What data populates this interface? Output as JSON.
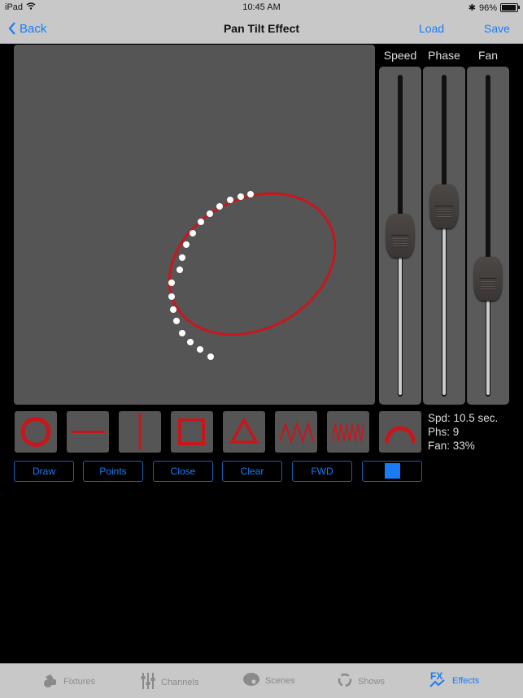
{
  "status_bar": {
    "device": "iPad",
    "time": "10:45 AM",
    "battery": "96%"
  },
  "nav": {
    "back_label": "Back",
    "title": "Pan Tilt Effect",
    "load_label": "Load",
    "save_label": "Save"
  },
  "sliders": [
    {
      "label": "Speed",
      "value_fraction": 0.5
    },
    {
      "label": "Phase",
      "value_fraction": 0.6
    },
    {
      "label": "Fan",
      "value_fraction": 0.35
    }
  ],
  "shapes": [
    "circle",
    "horizontal-line",
    "vertical-line",
    "square",
    "triangle",
    "zigzag",
    "zigzag-dense",
    "arc"
  ],
  "info": {
    "speed": "Spd: 10.5 sec.",
    "phase": "Phs: 9",
    "fan": "Fan: 33%"
  },
  "actions": [
    {
      "label": "Draw"
    },
    {
      "label": "Points"
    },
    {
      "label": "Close"
    },
    {
      "label": "Clear"
    },
    {
      "label": "FWD"
    },
    {
      "label": ""
    }
  ],
  "colors": {
    "accent": "#1a7cf5",
    "shape": "#c8161d",
    "path": "#c8161d",
    "color_swatch": "#1a7cf5"
  },
  "tabs": [
    {
      "label": "Fixtures",
      "icon": "fixture-icon",
      "active": false
    },
    {
      "label": "Channels",
      "icon": "sliders-icon",
      "active": false
    },
    {
      "label": "Scenes",
      "icon": "palette-icon",
      "active": false
    },
    {
      "label": "Shows",
      "icon": "loop-icon",
      "active": false
    },
    {
      "label": "Effects",
      "icon": "fx-icon",
      "active": true
    }
  ]
}
